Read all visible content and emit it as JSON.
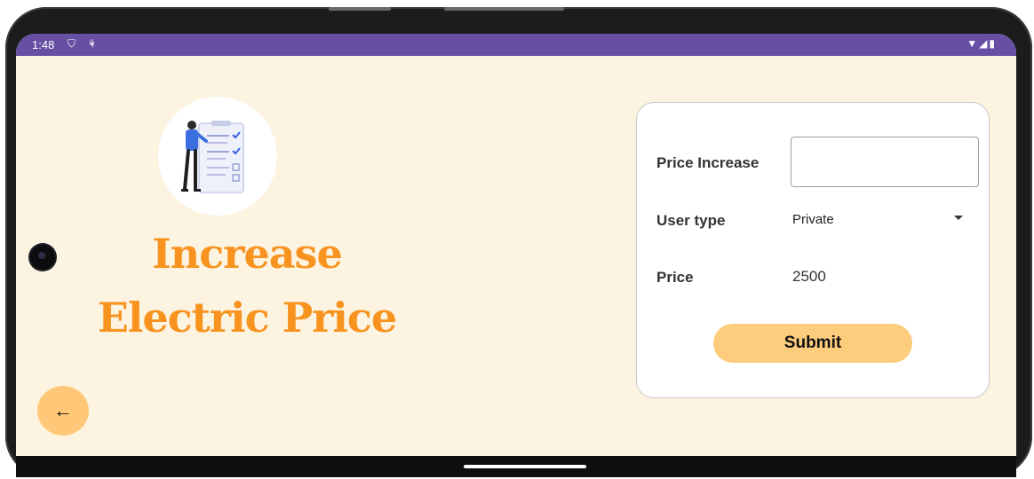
{
  "status_bar": {
    "time": "1:48",
    "left_icons": "⛉ ⚘",
    "right_icons": "▼◢▮",
    "color": "#6750a4"
  },
  "hero": {
    "icon": "clipboard-checklist-illustration",
    "title_line1": "Increase",
    "title_line2": "Electric Price",
    "title_color": "#f7931e"
  },
  "form": {
    "price_increase_label": "Price Increase",
    "price_increase_value": "",
    "user_type_label": "User type",
    "user_type_selected": "Private",
    "price_label": "Price",
    "price_value": "2500",
    "submit_label": "Submit",
    "button_color": "#fdcc7c"
  },
  "back_button": {
    "icon": "arrow-left-icon",
    "glyph": "←",
    "color": "#ffc878"
  },
  "background_color": "#fcf3e0"
}
